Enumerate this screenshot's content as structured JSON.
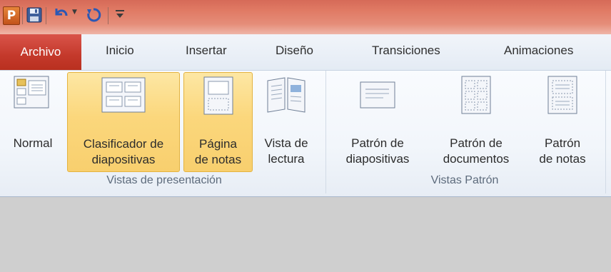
{
  "app": {
    "logo_letter": "P",
    "accent_color": "#c4392b"
  },
  "quick_access": [
    {
      "icon": "save-icon"
    },
    {
      "icon": "undo-icon"
    },
    {
      "icon": "redo-icon"
    },
    {
      "icon": "customize-icon"
    }
  ],
  "tabs": {
    "file": "Archivo",
    "items": [
      "Inicio",
      "Insertar",
      "Diseño",
      "Transiciones",
      "Animaciones"
    ]
  },
  "ribbon": {
    "group1": {
      "label": "Vistas de presentación",
      "buttons": [
        {
          "line1": "Normal",
          "line2": "",
          "icon": "normal-view-icon",
          "active": false
        },
        {
          "line1": "Clasificador de",
          "line2": "diapositivas",
          "icon": "slide-sorter-icon",
          "active": true
        },
        {
          "line1": "Página",
          "line2": "de notas",
          "icon": "notes-page-icon",
          "active": true
        },
        {
          "line1": "Vista de",
          "line2": "lectura",
          "icon": "reading-view-icon",
          "active": false
        }
      ]
    },
    "group2": {
      "label": "Vistas Patrón",
      "buttons": [
        {
          "line1": "Patrón de",
          "line2": "diapositivas",
          "icon": "slide-master-icon",
          "active": false
        },
        {
          "line1": "Patrón de",
          "line2": "documentos",
          "icon": "handout-master-icon",
          "active": false
        },
        {
          "line1": "Patrón",
          "line2": "de notas",
          "icon": "notes-master-icon",
          "active": false
        }
      ]
    }
  }
}
